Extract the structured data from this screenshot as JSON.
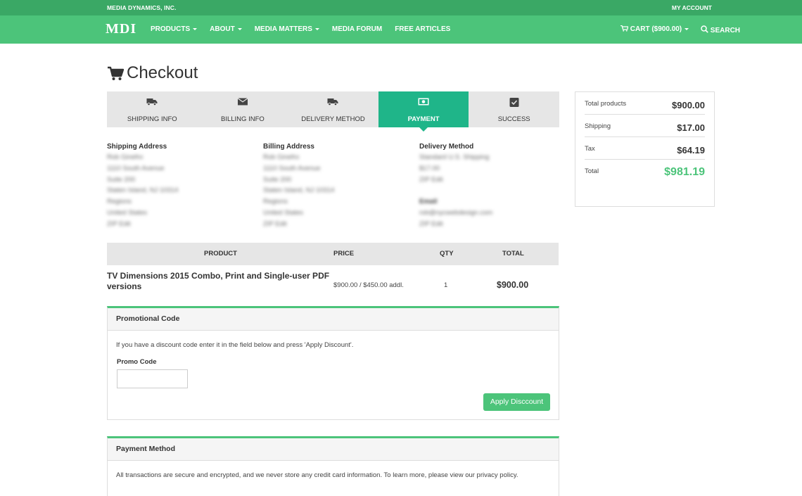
{
  "topbar": {
    "company": "MEDIA DYNAMICS, INC.",
    "my_account": "MY ACCOUNT"
  },
  "navbar": {
    "logo": "MDI",
    "items": [
      {
        "label": "PRODUCTS",
        "dropdown": true
      },
      {
        "label": "ABOUT",
        "dropdown": true
      },
      {
        "label": "MEDIA MATTERS",
        "dropdown": true
      },
      {
        "label": "MEDIA FORUM",
        "dropdown": false
      },
      {
        "label": "FREE ARTICLES",
        "dropdown": false
      }
    ],
    "cart": "CART ($900.00)",
    "search": "SEARCH"
  },
  "page": {
    "title": "Checkout"
  },
  "steps": [
    {
      "label": "SHIPPING INFO",
      "icon": "truck-icon",
      "active": false
    },
    {
      "label": "BILLING INFO",
      "icon": "envelope-icon",
      "active": false
    },
    {
      "label": "DELIVERY METHOD",
      "icon": "truck-icon",
      "active": false
    },
    {
      "label": "PAYMENT",
      "icon": "money-icon",
      "active": true
    },
    {
      "label": "SUCCESS",
      "icon": "checkbox-icon",
      "active": false
    }
  ],
  "shipping_address": {
    "heading": "Shipping Address",
    "lines": [
      "Rob Ginefro",
      "1110 South Avenue",
      "Suite 200",
      "Staten Island, NJ 10314",
      "Regions",
      "United States",
      "ZIP Edit"
    ]
  },
  "billing_address": {
    "heading": "Billing Address",
    "lines": [
      "Rob Ginefro",
      "1110 South Avenue",
      "Suite 200",
      "Staten Island, NJ 10314",
      "Regions",
      "United States",
      "ZIP Edit"
    ]
  },
  "delivery": {
    "heading": "Delivery Method",
    "lines": [
      "Standard U.S. Shipping",
      "$17.00",
      "ZIP Edit"
    ],
    "email_heading": "Email",
    "email_lines": [
      "rob@nycwebdesign.com",
      "ZIP Edit"
    ]
  },
  "products_table": {
    "headers": {
      "product": "PRODUCT",
      "price": "PRICE",
      "qty": "QTY",
      "total": "TOTAL"
    },
    "rows": [
      {
        "product": "TV Dimensions 2015 Combo, Print and Single-user PDF versions",
        "price": "$900.00 / $450.00 addl.",
        "qty": "1",
        "total": "$900.00"
      }
    ]
  },
  "promo": {
    "heading": "Promotional Code",
    "text": "If you have a discount code enter it in the field below and press 'Apply Discount'.",
    "label": "Promo Code",
    "value": "",
    "button": "Apply Disccount"
  },
  "payment": {
    "heading": "Payment Method",
    "text": "All transactions are secure and encrypted, and we never store any credit card information. To learn more, please view our privacy policy."
  },
  "summary": {
    "rows": [
      {
        "label": "Total products",
        "value": "$900.00"
      },
      {
        "label": "Shipping",
        "value": "$17.00"
      },
      {
        "label": "Tax",
        "value": "$64.19"
      },
      {
        "label": "Total",
        "value": "$981.19"
      }
    ]
  },
  "colors": {
    "brand_green": "#4cc47a",
    "brand_dark_green": "#3aa865",
    "active_step": "#1fb589"
  }
}
